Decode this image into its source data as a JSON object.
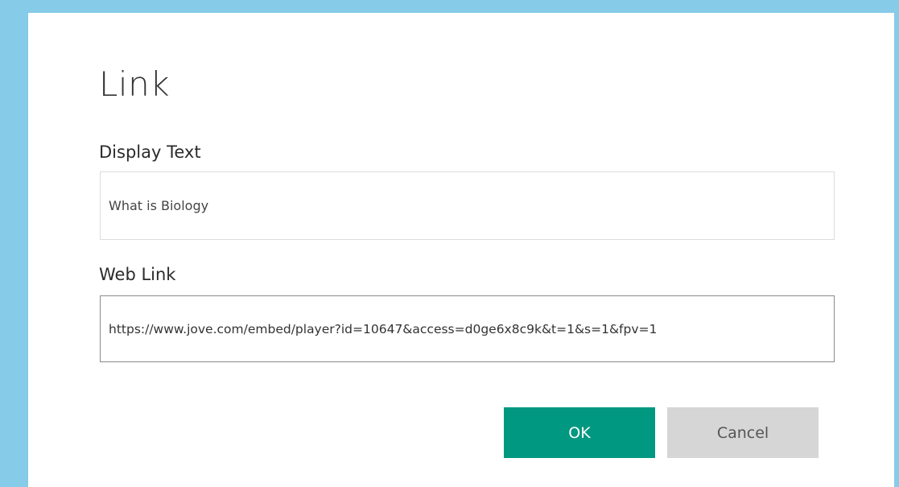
{
  "dialog": {
    "title": "Link",
    "display_text": {
      "label": "Display Text",
      "value": "What is Biology"
    },
    "web_link": {
      "label": "Web Link",
      "value": "https://www.jove.com/embed/player?id=10647&access=d0ge6x8c9k&t=1&s=1&fpv=1"
    },
    "buttons": {
      "ok_label": "OK",
      "cancel_label": "Cancel"
    }
  },
  "colors": {
    "frame_border": "#86cbe8",
    "ok_button": "#009880",
    "cancel_button": "#d6d6d6"
  }
}
